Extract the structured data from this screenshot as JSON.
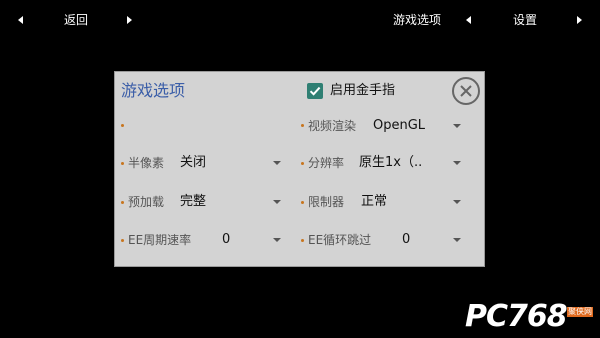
{
  "topbar": {
    "back_label": "返回",
    "game_options_label": "游戏选项",
    "settings_label": "设置"
  },
  "dialog": {
    "title": "游戏选项",
    "cheat_checkbox": {
      "label": "启用金手指",
      "checked": true
    },
    "options": {
      "video_render": {
        "label": "视频渲染",
        "value": "OpenGL"
      },
      "half_pixel": {
        "label": "半像素",
        "value": "关闭"
      },
      "resolution": {
        "label": "分辨率",
        "value": "原生1x（.."
      },
      "preload": {
        "label": "预加载",
        "value": "完整"
      },
      "limiter": {
        "label": "限制器",
        "value": "正常"
      },
      "ee_cycle_rate": {
        "label": "EE周期速率",
        "value": "0"
      },
      "ee_cycle_skip": {
        "label": "EE循环跳过",
        "value": "0"
      }
    }
  },
  "watermark": {
    "text": "PC768",
    "small": "聚侠网"
  },
  "colors": {
    "accent": "#2f7f73",
    "title": "#3b5ea8",
    "bullet": "#c8751e",
    "dialog_bg": "#d3d3d3"
  }
}
